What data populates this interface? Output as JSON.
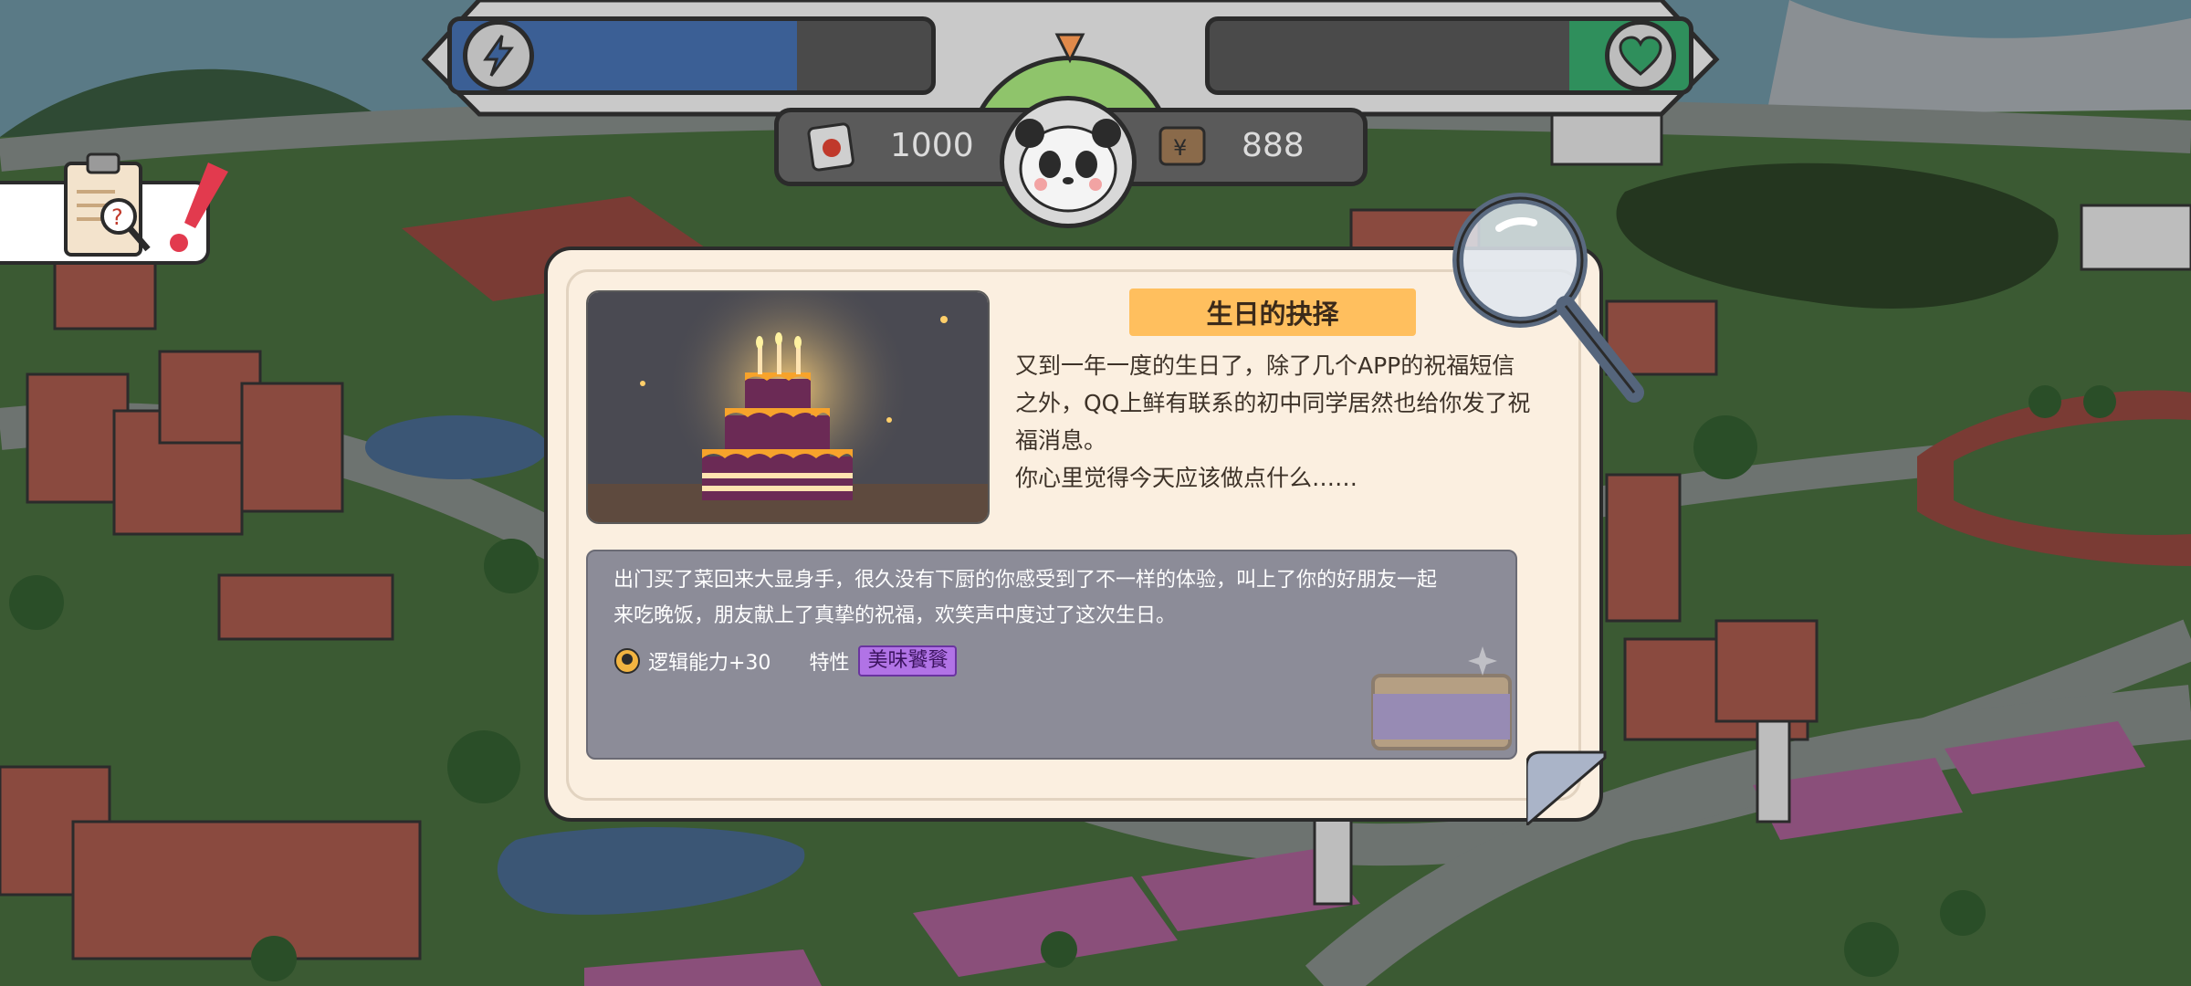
{
  "hud": {
    "energy_bar": {
      "icon": "lightning-icon",
      "fill_fraction": 0.72,
      "color": "#3b5f95"
    },
    "health_bar": {
      "icon": "heart-icon",
      "fill_fraction": 0.25,
      "color": "#2f8f5c"
    },
    "scroll_resource": {
      "icon": "scroll-icon",
      "value": "1000"
    },
    "money_resource": {
      "icon": "wallet-icon",
      "value": "888"
    },
    "avatar": "panda-avatar"
  },
  "quest": {
    "icon": "clipboard-search-icon",
    "alert_icon": "exclamation-icon"
  },
  "event": {
    "title": "生日的抉择",
    "story_lines": [
      "又到一年一度的生日了，除了几个APP的祝福短信",
      "之外，QQ上鲜有联系的初中同学居然也给你发了祝",
      "福消息。",
      "你心里觉得今天应该做点什么……"
    ],
    "result_lines": [
      "出门买了菜回来大显身手，很久没有下厨的你感受到了不一样的体验，叫上了你的好朋友一起",
      "来吃晚饭，朋友献上了真挚的祝福，欢笑声中度过了这次生日。"
    ],
    "effect_text": "逻辑能力+30",
    "trait_label": "特性",
    "trait_value": "美味饕餮",
    "title_color": "#ffbf5e",
    "trait_color": "#b173e6"
  }
}
